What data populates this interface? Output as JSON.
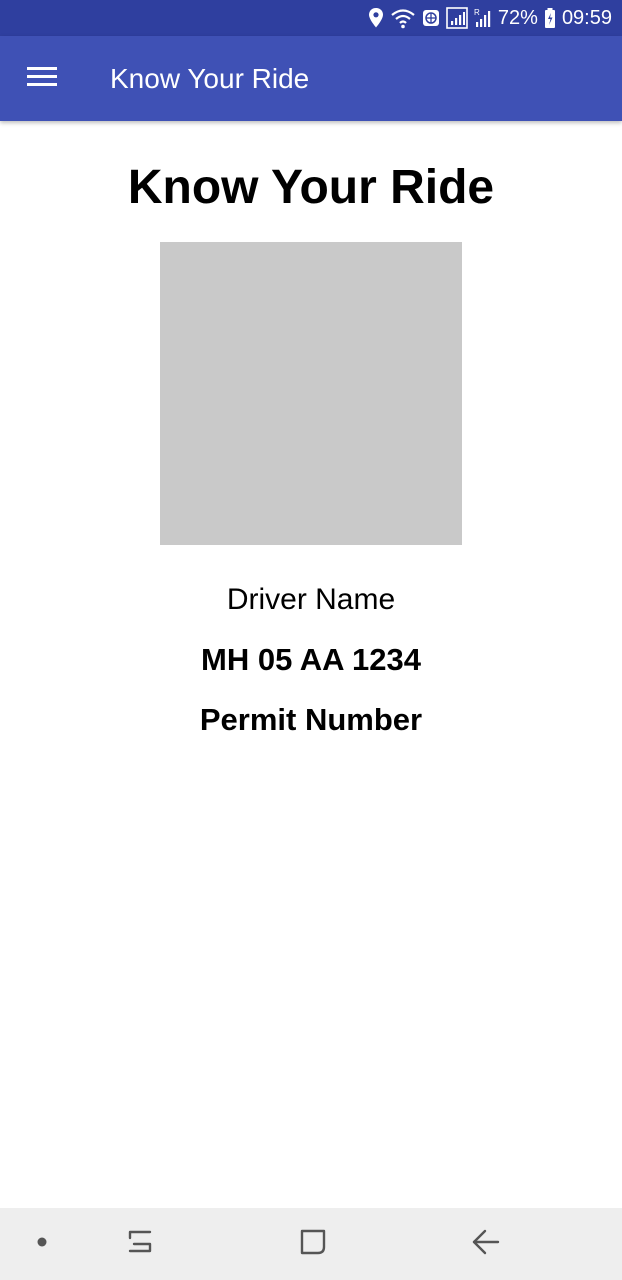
{
  "status_bar": {
    "battery": "72%",
    "time": "09:59",
    "icons": [
      "location-icon",
      "wifi-icon",
      "vpn-icon",
      "signal-icon",
      "signal-r-icon",
      "battery-icon"
    ]
  },
  "app_bar": {
    "title": "Know Your Ride",
    "menu_icon": "hamburger-menu-icon"
  },
  "main": {
    "heading": "Know Your Ride",
    "driver_name": "Driver Name",
    "vehicle_number": "MH 05 AA 1234",
    "permit_number": "Permit Number"
  },
  "nav_bar": {
    "items": [
      "dot-icon",
      "recent-apps-icon",
      "home-icon",
      "back-icon"
    ]
  },
  "colors": {
    "status_bar": "#2f3f9f",
    "app_bar": "#3f51b5",
    "photo_placeholder": "#c9c9c9",
    "nav_bar": "#eeeeee"
  }
}
